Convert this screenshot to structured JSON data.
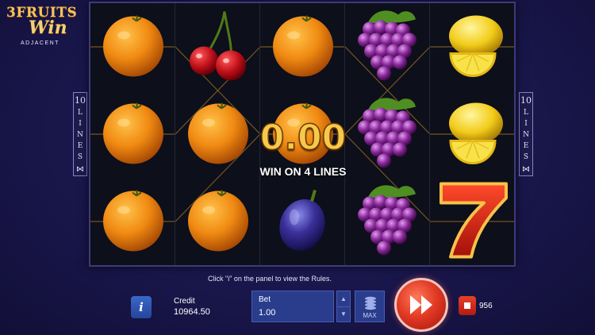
{
  "logo": {
    "line1": "3FRUITS",
    "line2": "Win",
    "line3": "ADJACENT"
  },
  "reels": [
    [
      "orange",
      "orange",
      "orange"
    ],
    [
      "cherry",
      "orange",
      "orange"
    ],
    [
      "orange",
      "orange",
      "plum"
    ],
    [
      "grapes",
      "grapes",
      "grapes"
    ],
    [
      "lemon",
      "lemon",
      "seven"
    ]
  ],
  "lines_panel": {
    "count": "10",
    "word": "LINES",
    "icon": "double-arrow-icon"
  },
  "win": {
    "amount": "0.00",
    "text": "WIN ON 4 LINES"
  },
  "hint": "Click \"i\" on the panel to view the Rules.",
  "panel": {
    "info_label": "i",
    "credit_label": "Credit",
    "credit_value": "10964.50",
    "bet_label": "Bet",
    "bet_value": "1.00",
    "max_label": "MAX",
    "autoplay_count": "956"
  },
  "colors": {
    "gold": "#f7c94b",
    "spin_red": "#e23a25",
    "panel_blue": "#2a3c8c",
    "background": "#1b1850"
  }
}
